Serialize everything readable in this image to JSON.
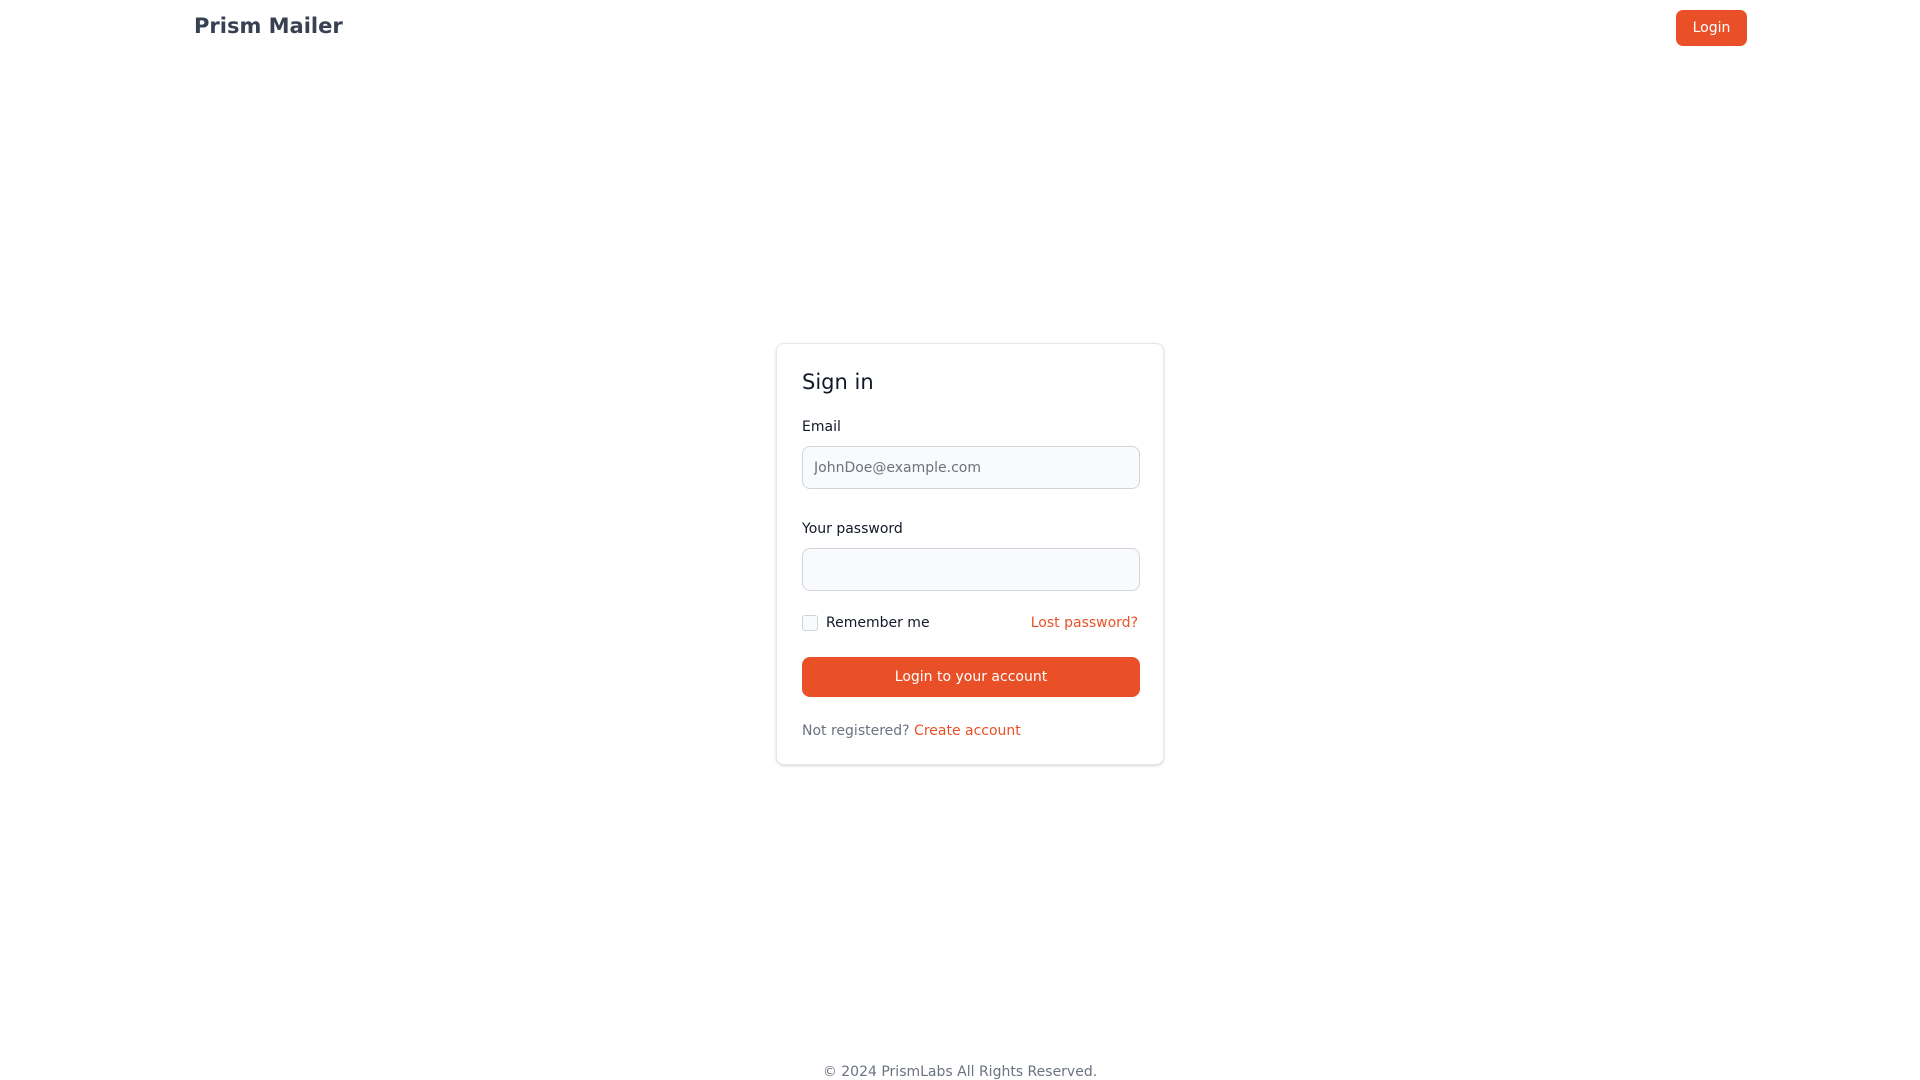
{
  "navbar": {
    "brand": "Prism Mailer",
    "login_label": "Login"
  },
  "signin": {
    "title": "Sign in",
    "email_label": "Email",
    "email_placeholder": "JohnDoe@example.com",
    "email_value": "",
    "password_label": "Your password",
    "password_value": "",
    "remember_label": "Remember me",
    "remember_checked": false,
    "lost_password": "Lost password?",
    "submit_label": "Login to your account",
    "not_registered": "Not registered?",
    "create_account": "Create account"
  },
  "footer": {
    "copyright": "© 2024 PrismLabs All Rights Reserved."
  },
  "colors": {
    "accent": "#ea5028",
    "brand_text": "#374151",
    "muted_text": "#6b7280"
  }
}
